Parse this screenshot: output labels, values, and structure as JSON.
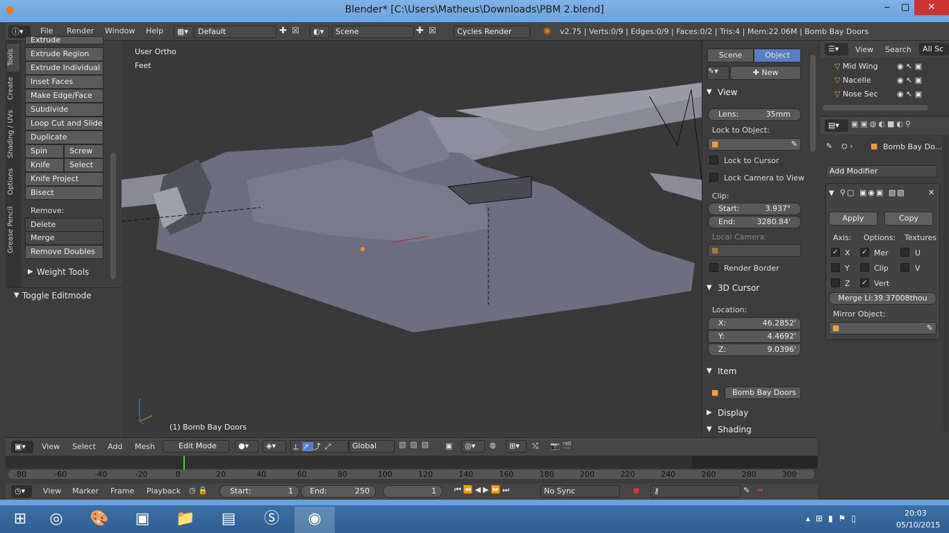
{
  "window": {
    "title": "Blender* [C:\\Users\\Matheus\\Downloads\\PBM 2.blend]",
    "minimize": "‒",
    "maximize": "□",
    "close": "✕"
  },
  "menu": [
    "File",
    "Render",
    "Window",
    "Help"
  ],
  "layout_name": "Default",
  "scene_name": "Scene",
  "render_engine": "Cycles Render",
  "stats": "v2.75 | Verts:0/9 | Edges:0/9 | Faces:0/2 | Tris:4 | Mem:22.06M | Bomb Bay Doors",
  "tabs": [
    "Tools",
    "Create",
    "Shading / UVs",
    "Options",
    "Grease Pencil"
  ],
  "tools": {
    "extrude": "Extrude",
    "extrude_region": "Extrude Region",
    "extrude_individual": "Extrude Individual",
    "inset_faces": "Inset Faces",
    "make_edge_face": "Make Edge/Face",
    "subdivide": "Subdivide",
    "loop_cut": "Loop Cut and Slide",
    "duplicate": "Duplicate",
    "spin": "Spin",
    "screw": "Screw",
    "knife": "Knife",
    "select": "Select",
    "knife_project": "Knife Project",
    "bisect": "Bisect",
    "remove_label": "Remove:",
    "delete": "Delete",
    "merge": "Merge",
    "remove_doubles": "Remove Doubles",
    "weight_tools": "Weight Tools",
    "toggle_editmode": "Toggle Editmode"
  },
  "viewport": {
    "view_name": "User Ortho",
    "units": "Feet",
    "object_label": "(1) Bomb Bay Doors"
  },
  "npanel": {
    "scene_tab": "Scene",
    "object_tab": "Object",
    "new_btn": "New",
    "view_header": "View",
    "lens_label": "Lens:",
    "lens_value": "35mm",
    "lock_to_object": "Lock to Object:",
    "lock_to_cursor": "Lock to Cursor",
    "lock_camera": "Lock Camera to View",
    "clip_label": "Clip:",
    "clip_start_label": "Start:",
    "clip_start": "3.937\"",
    "clip_end_label": "End:",
    "clip_end": "3280.84'",
    "local_camera": "Local Camera:",
    "render_border": "Render Border",
    "cursor_header": "3D Cursor",
    "location_label": "Location:",
    "x_label": "X:",
    "x": "46.2852'",
    "y_label": "Y:",
    "y": "4.4692'",
    "z_label": "Z:",
    "z": "9.0396'",
    "item_header": "Item",
    "item_name": "Bomb Bay Doors",
    "display_header": "Display",
    "shading_header": "Shading"
  },
  "outliner": {
    "view": "View",
    "search": "Search",
    "all_scenes": "All Sc",
    "items": [
      "Mid Wing",
      "Nacelle",
      "Nose Sec"
    ]
  },
  "properties": {
    "object_name": "Bomb Bay Do...",
    "add_modifier": "Add Modifier",
    "apply": "Apply",
    "copy": "Copy",
    "axis_label": "Axis:",
    "options_label": "Options:",
    "textures_label": "Textures",
    "x": "X",
    "y": "Y",
    "z": "Z",
    "merge": "Mer",
    "clipping": "Clip",
    "vertex": "Vert",
    "u": "U",
    "v": "V",
    "merge_limit": "Merge Li:39.37008thou",
    "mirror_object": "Mirror Object:"
  },
  "view3d_header": {
    "view": "View",
    "select": "Select",
    "add": "Add",
    "mesh": "Mesh",
    "mode": "Edit Mode",
    "orientation": "Global"
  },
  "timeline": {
    "ticks": [
      "-80",
      "-60",
      "-40",
      "-20",
      "0",
      "20",
      "40",
      "60",
      "80",
      "100",
      "120",
      "140",
      "160",
      "180",
      "200",
      "220",
      "240",
      "260",
      "280",
      "300"
    ],
    "view": "View",
    "marker": "Marker",
    "frame": "Frame",
    "playback": "Playback",
    "start_label": "Start:",
    "start": "1",
    "end_label": "End:",
    "end": "250",
    "current": "1",
    "sync": "No Sync"
  },
  "clock": {
    "time": "20:03",
    "date": "05/10/2015"
  },
  "colors": {
    "accent": "#5680c2",
    "header": "#464646",
    "panel": "#3d3d3d",
    "viewport": "#393939"
  }
}
